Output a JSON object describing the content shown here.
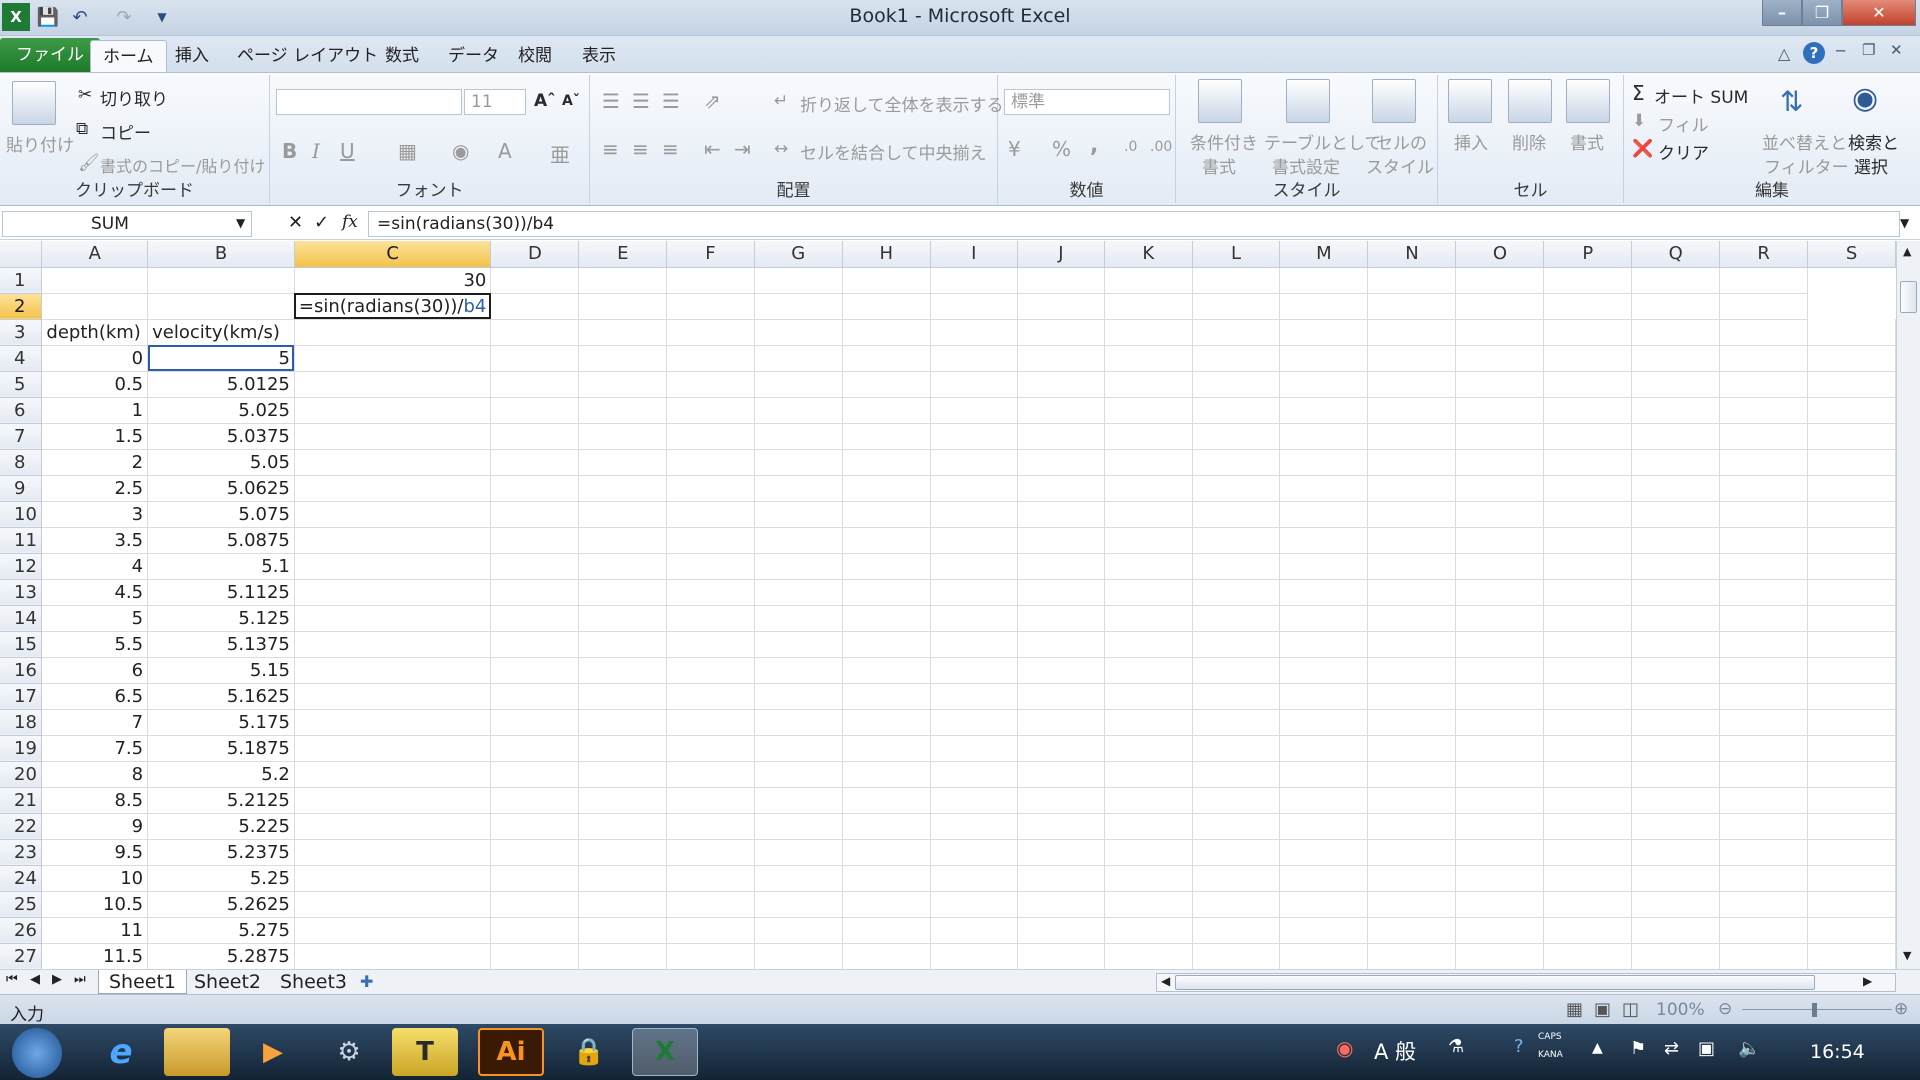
{
  "window": {
    "title": "Book1 - Microsoft Excel"
  },
  "quick_access": {
    "save_icon": "save-icon",
    "undo_icon": "undo-icon",
    "redo_icon": "redo-icon"
  },
  "tabs": [
    {
      "label": "ファイル"
    },
    {
      "label": "ホーム"
    },
    {
      "label": "挿入"
    },
    {
      "label": "ページ レイアウト"
    },
    {
      "label": "数式"
    },
    {
      "label": "データ"
    },
    {
      "label": "校閲"
    },
    {
      "label": "表示"
    }
  ],
  "ribbon": {
    "clipboard": {
      "group": "クリップボード",
      "paste": "貼り付け",
      "cut": "切り取り",
      "copy": "コピー",
      "format_painter": "書式のコピー/貼り付け"
    },
    "font": {
      "group": "フォント",
      "size": "11",
      "bold": "B",
      "italic": "I",
      "underline": "U",
      "font_color": "A"
    },
    "alignment": {
      "group": "配置",
      "wrap": "折り返して全体を表示する",
      "merge": "セルを結合して中央揃え"
    },
    "number": {
      "group": "数値",
      "format": "標準",
      "percent": "%",
      "comma": ","
    },
    "styles": {
      "group": "スタイル",
      "conditional_line1": "条件付き",
      "conditional_line2": "書式",
      "table_line1": "テーブルとして",
      "table_line2": "書式設定",
      "cell_line1": "セルの",
      "cell_line2": "スタイル"
    },
    "cells": {
      "group": "セル",
      "insert": "挿入",
      "delete": "削除",
      "format": "書式"
    },
    "editing": {
      "group": "編集",
      "autosum": "オート SUM",
      "fill": "フィル",
      "clear": "クリア",
      "sort_line1": "並べ替えと",
      "sort_line2": "フィルター",
      "find_line1": "検索と",
      "find_line2": "選択"
    }
  },
  "formula_bar": {
    "name_box": "SUM",
    "formula": "=sin(radians(30))/b4",
    "fx": "fx",
    "cancel": "✕",
    "enter": "✓"
  },
  "columns": [
    "A",
    "B",
    "C",
    "D",
    "E",
    "F",
    "G",
    "H",
    "I",
    "J",
    "K",
    "L",
    "M",
    "N",
    "O",
    "P",
    "Q",
    "R",
    "S"
  ],
  "cells": {
    "C1": "30",
    "C2_prefix": "=sin(radians(30))/",
    "C2_ref": "b4",
    "A3": "depth(km)",
    "B3": "velocity(km/s)"
  },
  "rows": [
    {
      "n": "4",
      "a": "0",
      "b": "5"
    },
    {
      "n": "5",
      "a": "0.5",
      "b": "5.0125"
    },
    {
      "n": "6",
      "a": "1",
      "b": "5.025"
    },
    {
      "n": "7",
      "a": "1.5",
      "b": "5.0375"
    },
    {
      "n": "8",
      "a": "2",
      "b": "5.05"
    },
    {
      "n": "9",
      "a": "2.5",
      "b": "5.0625"
    },
    {
      "n": "10",
      "a": "3",
      "b": "5.075"
    },
    {
      "n": "11",
      "a": "3.5",
      "b": "5.0875"
    },
    {
      "n": "12",
      "a": "4",
      "b": "5.1"
    },
    {
      "n": "13",
      "a": "4.5",
      "b": "5.1125"
    },
    {
      "n": "14",
      "a": "5",
      "b": "5.125"
    },
    {
      "n": "15",
      "a": "5.5",
      "b": "5.1375"
    },
    {
      "n": "16",
      "a": "6",
      "b": "5.15"
    },
    {
      "n": "17",
      "a": "6.5",
      "b": "5.1625"
    },
    {
      "n": "18",
      "a": "7",
      "b": "5.175"
    },
    {
      "n": "19",
      "a": "7.5",
      "b": "5.1875"
    },
    {
      "n": "20",
      "a": "8",
      "b": "5.2"
    },
    {
      "n": "21",
      "a": "8.5",
      "b": "5.2125"
    },
    {
      "n": "22",
      "a": "9",
      "b": "5.225"
    },
    {
      "n": "23",
      "a": "9.5",
      "b": "5.2375"
    },
    {
      "n": "24",
      "a": "10",
      "b": "5.25"
    },
    {
      "n": "25",
      "a": "10.5",
      "b": "5.2625"
    },
    {
      "n": "26",
      "a": "11",
      "b": "5.275"
    },
    {
      "n": "27",
      "a": "11.5",
      "b": "5.2875"
    }
  ],
  "sheets": [
    "Sheet1",
    "Sheet2",
    "Sheet3"
  ],
  "status": {
    "mode": "入力",
    "zoom": "100%"
  },
  "taskbar": {
    "clock": "16:54",
    "ime": "A 般",
    "illustrator": "Ai",
    "caps": "CAPS",
    "kana": "KANA"
  }
}
